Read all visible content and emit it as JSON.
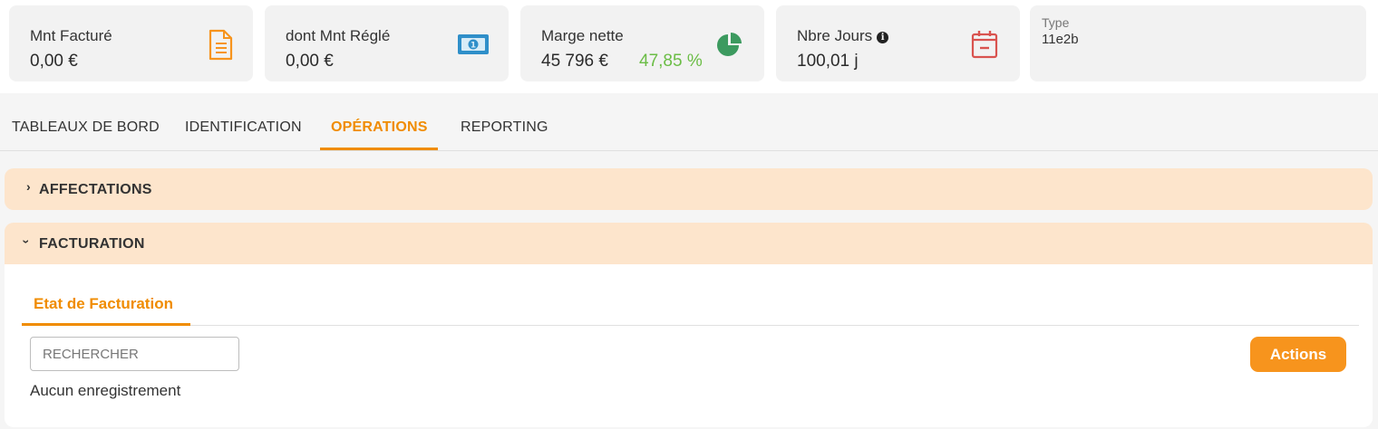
{
  "kpis": [
    {
      "label": "Mnt Facturé",
      "value": "0,00 €",
      "icon": "invoice-document-icon",
      "color": "#f7941d"
    },
    {
      "label": "dont Mnt Réglé",
      "value": "0,00 €",
      "icon": "banknote-icon",
      "color": "#2f8fc9"
    },
    {
      "label": "Marge nette",
      "value": "45 796 €",
      "percent": "47,85 %",
      "icon": "pie-chart-icon",
      "color": "#3c9a5f",
      "percent_color": "#6bbd46"
    },
    {
      "label": "Nbre Jours",
      "value": "100,01 j",
      "icon": "calendar-icon",
      "color": "#d9534f",
      "info_icon": "info-icon"
    }
  ],
  "type_card": {
    "label": "Type",
    "value": "11e2b"
  },
  "tabs": [
    {
      "label": "TABLEAUX DE BORD",
      "active": false
    },
    {
      "label": "IDENTIFICATION",
      "active": false
    },
    {
      "label": "OPÉRATIONS",
      "active": true
    },
    {
      "label": "REPORTING",
      "active": false
    }
  ],
  "sections": [
    {
      "title": "AFFECTATIONS",
      "expanded": false,
      "chevron": "›"
    },
    {
      "title": "FACTURATION",
      "expanded": true,
      "chevron": "›"
    }
  ],
  "facturation": {
    "subtab": "Etat de Facturation",
    "search_placeholder": "RECHERCHER",
    "search_value": "",
    "actions_label": "Actions",
    "empty_text": "Aucun enregistrement"
  },
  "colors": {
    "accent": "#f08c00",
    "button": "#f7941d",
    "section_bg": "#fde5cc"
  }
}
